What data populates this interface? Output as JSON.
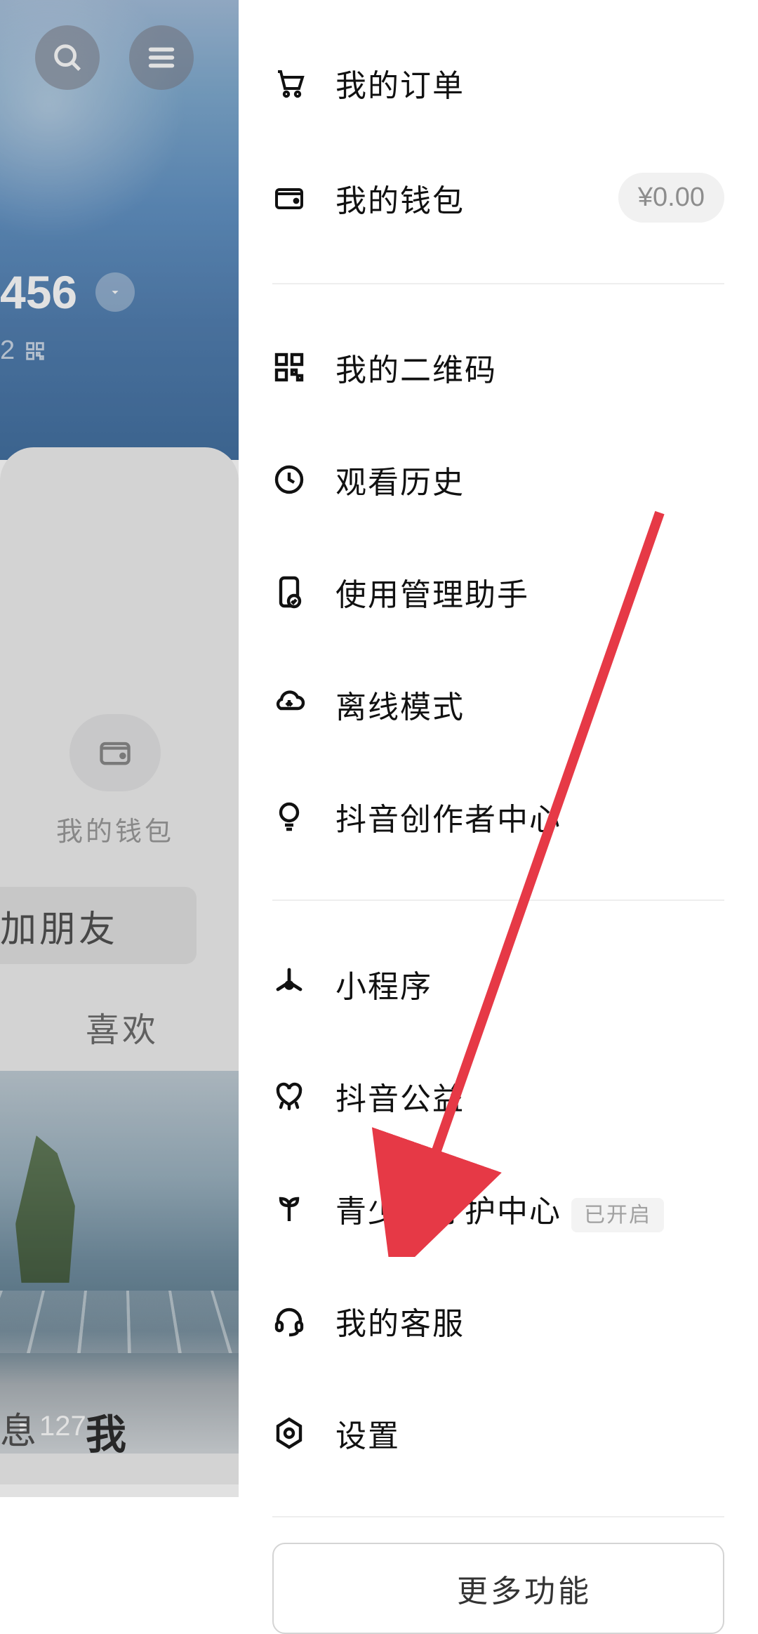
{
  "background": {
    "id_suffix": "456",
    "sub_num": "2",
    "wallet_label": "我的钱包",
    "add_friend_label": "加朋友",
    "tab_like": "喜欢",
    "thumb_count": "127",
    "nav_messages": "息",
    "nav_me": "我"
  },
  "drawer": {
    "section1": {
      "orders": "我的订单",
      "wallet": "我的钱包",
      "wallet_amount": "¥0.00"
    },
    "section2": {
      "qrcode": "我的二维码",
      "history": "观看历史",
      "assistant": "使用管理助手",
      "offline": "离线模式",
      "creator": "抖音创作者中心"
    },
    "section3": {
      "miniapp": "小程序",
      "charity": "抖音公益",
      "teen": "青少年守护中心",
      "teen_tag": "已开启",
      "support": "我的客服",
      "settings": "设置"
    },
    "more": "更多功能"
  }
}
